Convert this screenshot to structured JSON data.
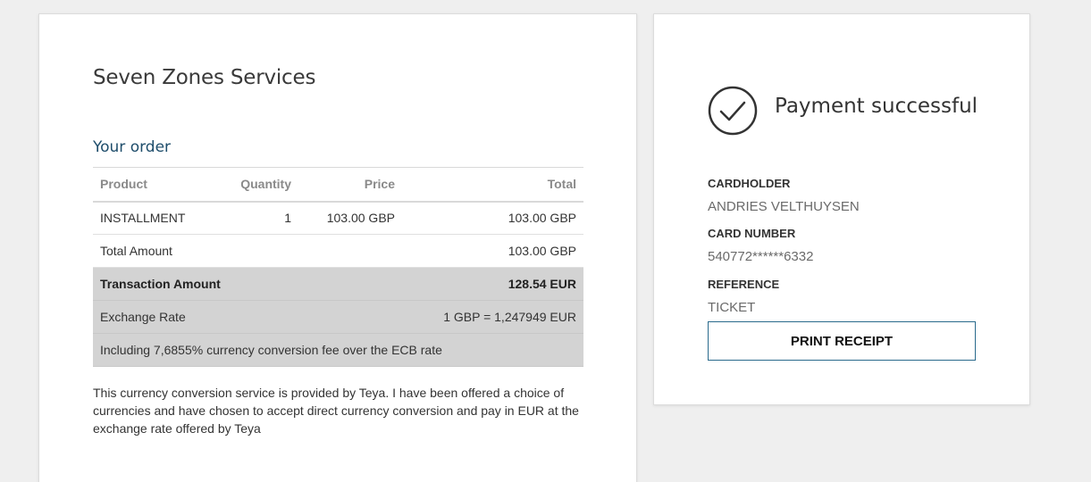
{
  "merchant_name": "Seven Zones Services",
  "order": {
    "heading": "Your order",
    "columns": {
      "product": "Product",
      "quantity": "Quantity",
      "price": "Price",
      "total": "Total"
    },
    "items": [
      {
        "product": "INSTALLMENT",
        "quantity": "1",
        "price": "103.00 GBP",
        "total": "103.00 GBP"
      }
    ],
    "total_amount_label": "Total Amount",
    "total_amount_value": "103.00 GBP",
    "transaction_amount_label": "Transaction Amount",
    "transaction_amount_value": "128.54 EUR",
    "exchange_rate_label": "Exchange Rate",
    "exchange_rate_value": "1 GBP = 1,247949 EUR",
    "fee_note": "Including 7,6855% currency conversion fee over the ECB rate"
  },
  "disclaimer": "This currency conversion service is provided by Teya. I have been offered a choice of currencies and have chosen to accept direct currency conversion and pay in EUR at the exchange rate offered by Teya",
  "payment": {
    "status_icon": "check-circle-icon",
    "status_text": "Payment successful",
    "cardholder_label": "CARDHOLDER",
    "cardholder_value": "ANDRIES VELTHUYSEN",
    "card_number_label": "CARD NUMBER",
    "card_number_value": "540772******6332",
    "reference_label": "REFERENCE",
    "reference_value": "TICKET",
    "print_button_label": "PRINT RECEIPT"
  },
  "colors": {
    "accent": "#1e4d6b",
    "button_border": "#2a6a8c",
    "highlight_rows": "#d3d3d3",
    "background": "#efefef"
  }
}
